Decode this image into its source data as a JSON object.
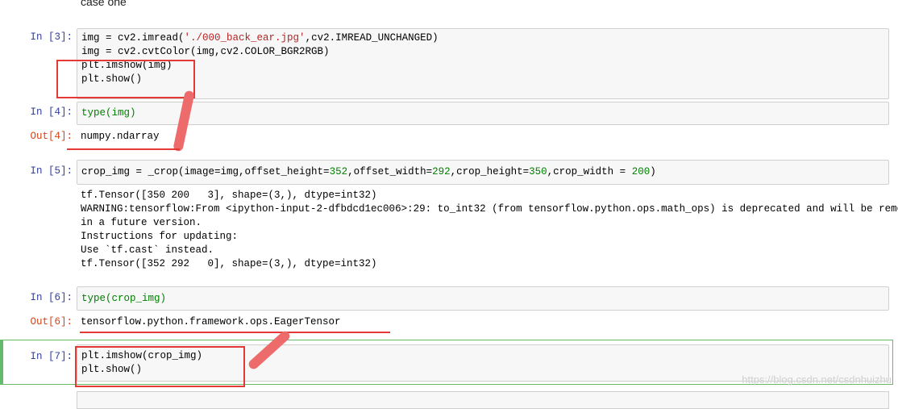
{
  "heading": "case one",
  "cells": {
    "c3": {
      "prompt": "In  [3]:",
      "lines": [
        [
          "img = cv2.imread(",
          "'./000_back_ear.jpg'",
          ",cv2.IMREAD_UNCHANGED)"
        ],
        [
          "img = cv2.cvtColor(img,cv2.COLOR_BGR2RGB)"
        ],
        [
          "plt.imshow(img)"
        ],
        [
          "plt.show()"
        ]
      ]
    },
    "c4": {
      "prompt": "In  [4]:",
      "code": "type(img)",
      "out_prompt": "Out[4]:",
      "output": "numpy.ndarray"
    },
    "c5": {
      "prompt": "In  [5]:",
      "code_parts": [
        "crop_img = _crop(image=img,offset_height=",
        "352",
        ",offset_width=",
        "292",
        ",crop_height=",
        "350",
        ",crop_width = ",
        "200",
        ")"
      ],
      "stream": [
        "tf.Tensor([350 200   3], shape=(3,), dtype=int32)",
        "WARNING:tensorflow:From <ipython-input-2-dfbdcd1ec006>:29: to_int32 (from tensorflow.python.ops.math_ops) is deprecated and will be removed",
        "in a future version.",
        "Instructions for updating:",
        "Use `tf.cast` instead.",
        "tf.Tensor([352 292   0], shape=(3,), dtype=int32)"
      ]
    },
    "c6": {
      "prompt": "In  [6]:",
      "code": "type(crop_img)",
      "out_prompt": "Out[6]:",
      "output": "tensorflow.python.framework.ops.EagerTensor"
    },
    "c7": {
      "prompt": "In  [7]:",
      "lines": [
        "plt.imshow(crop_img)",
        "plt.show()"
      ]
    }
  },
  "watermark": "https://blog.csdn.net/csdnhuizhu",
  "colors": {
    "in_prompt": "#303f9f",
    "out_prompt": "#d84315",
    "annotation_red": "#e53935",
    "selected_border": "#66bb6a"
  }
}
